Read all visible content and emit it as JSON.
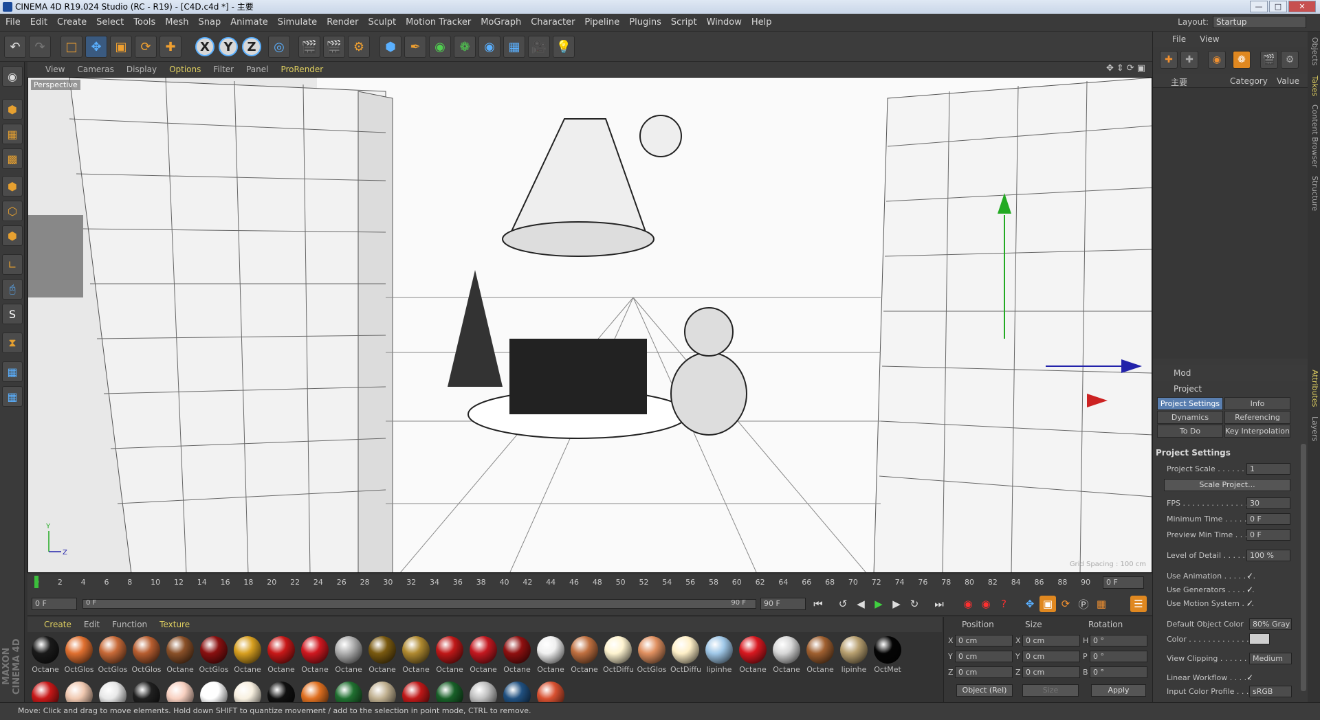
{
  "window": {
    "title": "CINEMA 4D R19.024 Studio (RC - R19) - [C4D.c4d *] - 主要"
  },
  "menu": [
    "File",
    "Edit",
    "Create",
    "Select",
    "Tools",
    "Mesh",
    "Snap",
    "Animate",
    "Simulate",
    "Render",
    "Sculpt",
    "Motion Tracker",
    "MoGraph",
    "Character",
    "Pipeline",
    "Plugins",
    "Script",
    "Window",
    "Help"
  ],
  "layout": {
    "label": "Layout:",
    "value": "Startup"
  },
  "toolbar": {
    "icons": [
      "undo-icon",
      "redo-icon",
      "live-selection-icon",
      "move-icon",
      "scale-icon",
      "rotate-icon",
      "recent-tool-icon",
      "x-axis-lock-icon",
      "y-axis-lock-icon",
      "z-axis-lock-icon",
      "coordinate-system-icon",
      "render-view-icon",
      "render-picture-viewer-icon",
      "edit-render-settings-icon",
      "cube-icon",
      "pen-icon",
      "subdivision-icon",
      "array-icon",
      "deformer-icon",
      "floor-icon",
      "camera-icon",
      "light-icon"
    ],
    "axis_x": "X",
    "axis_y": "Y",
    "axis_z": "Z"
  },
  "left_tools": [
    "make-editable-icon",
    "model-mode-icon",
    "texture-mode-icon",
    "workplane-mode-icon",
    "points-mode-icon",
    "edges-mode-icon",
    "polygons-mode-icon",
    "axis-mode-icon",
    "tweak-mode-icon",
    "solo-icon",
    "snapping-icon",
    "workplane-lock-icon",
    "viewport-solo-icon"
  ],
  "viewport": {
    "menu": [
      "View",
      "Cameras",
      "Display",
      "Options",
      "Filter",
      "Panel",
      "ProRender"
    ],
    "label": "Perspective",
    "hud": "Grid Spacing : 100 cm",
    "axis_y": "Y",
    "axis_z": "Z"
  },
  "timeline": {
    "ticks": [
      "0",
      "2",
      "4",
      "6",
      "8",
      "10",
      "12",
      "14",
      "16",
      "18",
      "20",
      "22",
      "24",
      "26",
      "28",
      "30",
      "32",
      "34",
      "36",
      "38",
      "40",
      "42",
      "44",
      "46",
      "48",
      "50",
      "52",
      "54",
      "56",
      "58",
      "60",
      "62",
      "64",
      "66",
      "68",
      "70",
      "72",
      "74",
      "76",
      "78",
      "80",
      "82",
      "84",
      "86",
      "88",
      "90"
    ],
    "current": "0 F"
  },
  "transport": {
    "start": "0 F",
    "min": "0 F",
    "max": "90 F",
    "end": "90 F"
  },
  "materials": {
    "menu": [
      "Create",
      "Edit",
      "Function",
      "Texture"
    ],
    "row1": [
      {
        "label": "Octane",
        "color": "#1a1a1a"
      },
      {
        "label": "OctGlos",
        "color": "#e07030"
      },
      {
        "label": "OctGlos",
        "color": "#c86a38"
      },
      {
        "label": "OctGlos",
        "color": "#b85e30"
      },
      {
        "label": "Octane",
        "color": "#8a5028"
      },
      {
        "label": "OctGlos",
        "color": "#8a1010"
      },
      {
        "label": "Octane",
        "color": "#d8a020"
      },
      {
        "label": "Octane",
        "color": "#c81818"
      },
      {
        "label": "Octane",
        "color": "#d01820"
      },
      {
        "label": "Octane",
        "color": "#b0b0b0"
      },
      {
        "label": "Octane",
        "color": "#7a5a10"
      },
      {
        "label": "Octane",
        "color": "#b08a30"
      },
      {
        "label": "Octane",
        "color": "#c01818"
      },
      {
        "label": "Octane",
        "color": "#c41820"
      },
      {
        "label": "Octane",
        "color": "#901010"
      },
      {
        "label": "Octane",
        "color": "#f0f0f0"
      },
      {
        "label": "Octane",
        "color": "#c07040"
      },
      {
        "label": "OctDiffu",
        "color": "#fff4d0"
      },
      {
        "label": "OctGlos",
        "color": "#e09060"
      },
      {
        "label": "OctDiffu",
        "color": "#fff0c8"
      },
      {
        "label": "lipinhe",
        "color": "#a0c8e8"
      },
      {
        "label": "Octane",
        "color": "#d81820"
      },
      {
        "label": "Octane",
        "color": "#d8d8d8"
      },
      {
        "label": "Octane",
        "color": "#a06030"
      },
      {
        "label": "lipinhe",
        "color": "#b8a070"
      },
      {
        "label": "OctMet",
        "color": "#050505"
      }
    ],
    "row2": [
      "#c81818",
      "#f0c8b0",
      "#e8e8e8",
      "#202020",
      "#f8d0c0",
      "#ffffff",
      "#f8f0e0",
      "#101010",
      "#e07020",
      "#207030",
      "#c0b090",
      "#c01818",
      "#186028",
      "#c0c0c0",
      "#205080",
      "#d85030"
    ]
  },
  "coords": {
    "headers": [
      "Position",
      "Size",
      "Rotation"
    ],
    "rows": [
      {
        "axis": "X",
        "pos": "0 cm",
        "size_axis": "X",
        "size": "0 cm",
        "rot_axis": "H",
        "rot": "0 °"
      },
      {
        "axis": "Y",
        "pos": "0 cm",
        "size_axis": "Y",
        "size": "0 cm",
        "rot_axis": "P",
        "rot": "0 °"
      },
      {
        "axis": "Z",
        "pos": "0 cm",
        "size_axis": "Z",
        "size": "0 cm",
        "rot_axis": "B",
        "rot": "0 °"
      }
    ],
    "mode": "Object (Rel)",
    "size_mode": "Size",
    "apply": "Apply"
  },
  "object_manager": {
    "menu": [
      "File",
      "View"
    ],
    "icons": [
      "add-object-icon",
      "render-tag-icon",
      "null-icon",
      "mograph-icon",
      "render-icon",
      "settings-icon"
    ],
    "columns": [
      "主要",
      "Category",
      "Value"
    ]
  },
  "attributes": {
    "menu": "Mod",
    "title": "Project",
    "tabs": [
      "Project Settings",
      "Info",
      "Dynamics",
      "Referencing",
      "To Do",
      "Key Interpolation"
    ],
    "section": "Project Settings",
    "rows": [
      {
        "label": "Project Scale . . . . . . .",
        "value": "1"
      },
      {
        "label": "FPS . . . . . . . . . . . . . . . .",
        "value": "30"
      },
      {
        "label": "Minimum Time . . . . . . .",
        "value": "0 F"
      },
      {
        "label": "Preview Min Time . . . .",
        "value": "0 F"
      },
      {
        "label": "Level of Detail . . . . . .",
        "value": "100 %"
      },
      {
        "label": "Use Animation . . . . . . .",
        "value": "✓"
      },
      {
        "label": "Use Generators . . . . . .",
        "value": "✓"
      },
      {
        "label": "Use Motion System . . .",
        "value": "✓"
      },
      {
        "label": "Default Object Color",
        "value": "80% Gray"
      },
      {
        "label": "Color . . . . . . . . . . . . . .",
        "value": ""
      },
      {
        "label": "View Clipping . . . . . . .",
        "value": "Medium"
      },
      {
        "label": "Linear Workflow . . . . .",
        "value": "✓"
      },
      {
        "label": "Input Color Profile . . .",
        "value": "sRGB"
      }
    ],
    "scale_button": "Scale Project..."
  },
  "side_tabs": [
    "Objects",
    "Takes",
    "Content Browser",
    "Structure",
    "Attributes",
    "Layers"
  ],
  "status": "Move: Click and drag to move elements. Hold down SHIFT to quantize movement / add to the selection in point mode, CTRL to remove."
}
